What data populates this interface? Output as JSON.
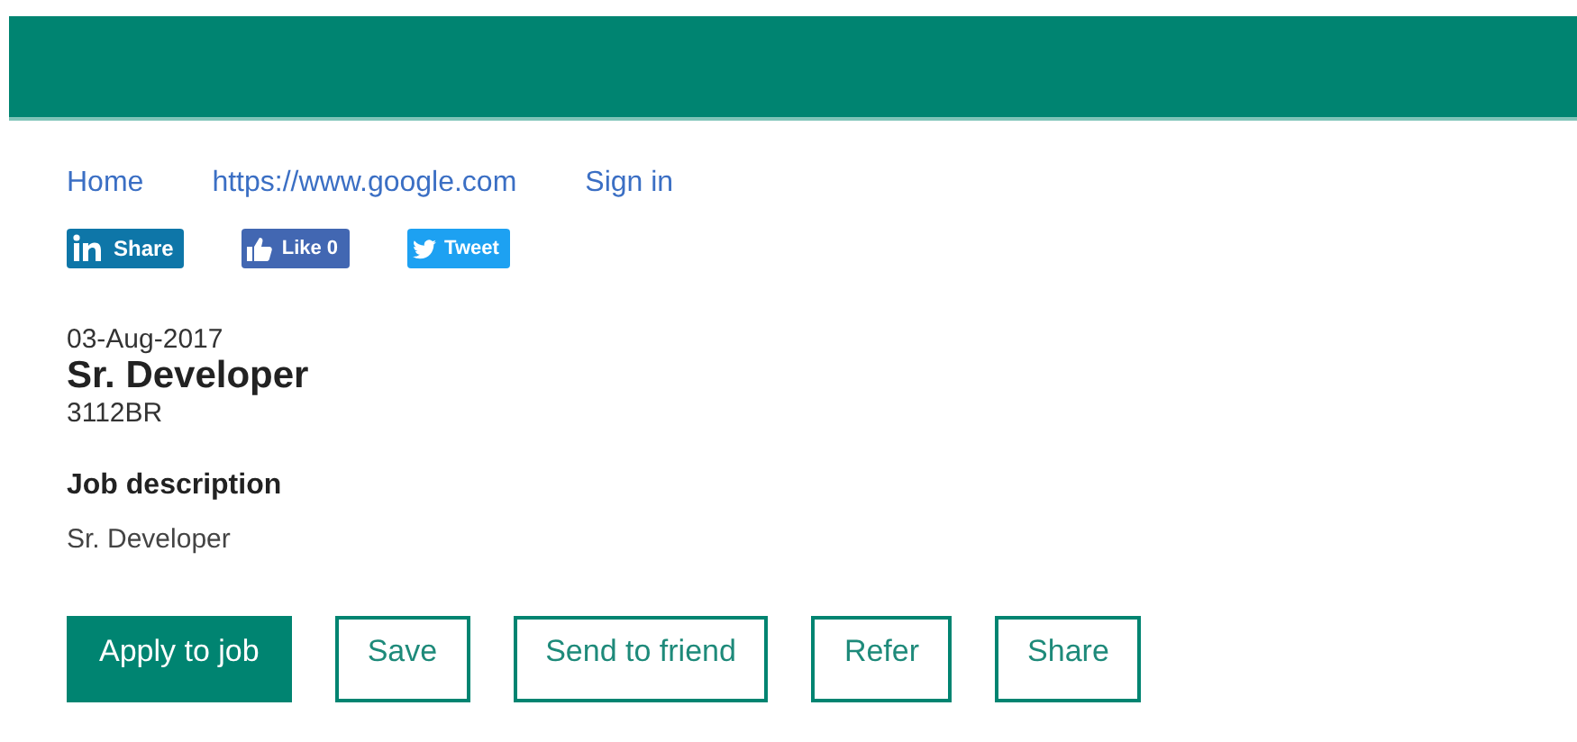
{
  "nav": [
    {
      "label": "Home"
    },
    {
      "label": "https://www.google.com"
    },
    {
      "label": "Sign in"
    }
  ],
  "social": [
    {
      "kind": "linkedin",
      "label": "Share"
    },
    {
      "kind": "facebook",
      "label": "Like 0"
    },
    {
      "kind": "twitter",
      "label": "Tweet"
    }
  ],
  "job": {
    "date": "03-Aug-2017",
    "title": "Sr. Developer",
    "code": "3112BR",
    "description_heading": "Job description",
    "description": "Sr. Developer"
  },
  "actions": [
    {
      "kind": "primary",
      "label": "Apply to job"
    },
    {
      "kind": "outline",
      "label": "Save"
    },
    {
      "kind": "outline",
      "label": "Send to friend"
    },
    {
      "kind": "outline",
      "label": "Refer"
    },
    {
      "kind": "outline",
      "label": "Share"
    }
  ]
}
